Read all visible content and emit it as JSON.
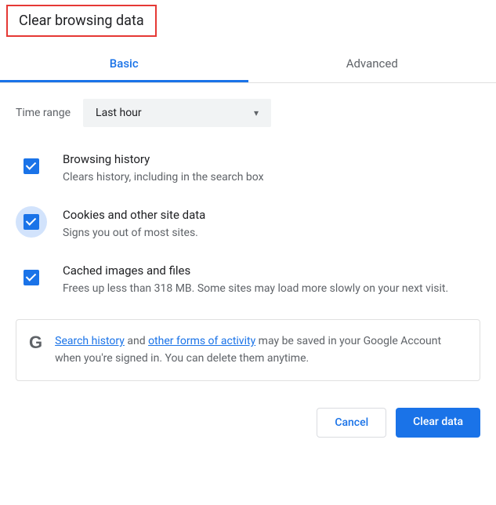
{
  "title": "Clear browsing data",
  "tabs": {
    "basic": "Basic",
    "advanced": "Advanced"
  },
  "time": {
    "label": "Time range",
    "value": "Last hour"
  },
  "options": {
    "browsing": {
      "title": "Browsing history",
      "desc": "Clears history, including in the search box"
    },
    "cookies": {
      "title": "Cookies and other site data",
      "desc": "Signs you out of most sites."
    },
    "cache": {
      "title": "Cached images and files",
      "desc": "Frees up less than 318 MB. Some sites may load more slowly on your next visit."
    }
  },
  "info": {
    "link1": "Search history",
    "mid1": " and ",
    "link2": "other forms of activity",
    "tail": " may be saved in your Google Account when you're signed in. You can delete them anytime."
  },
  "buttons": {
    "cancel": "Cancel",
    "clear": "Clear data"
  }
}
